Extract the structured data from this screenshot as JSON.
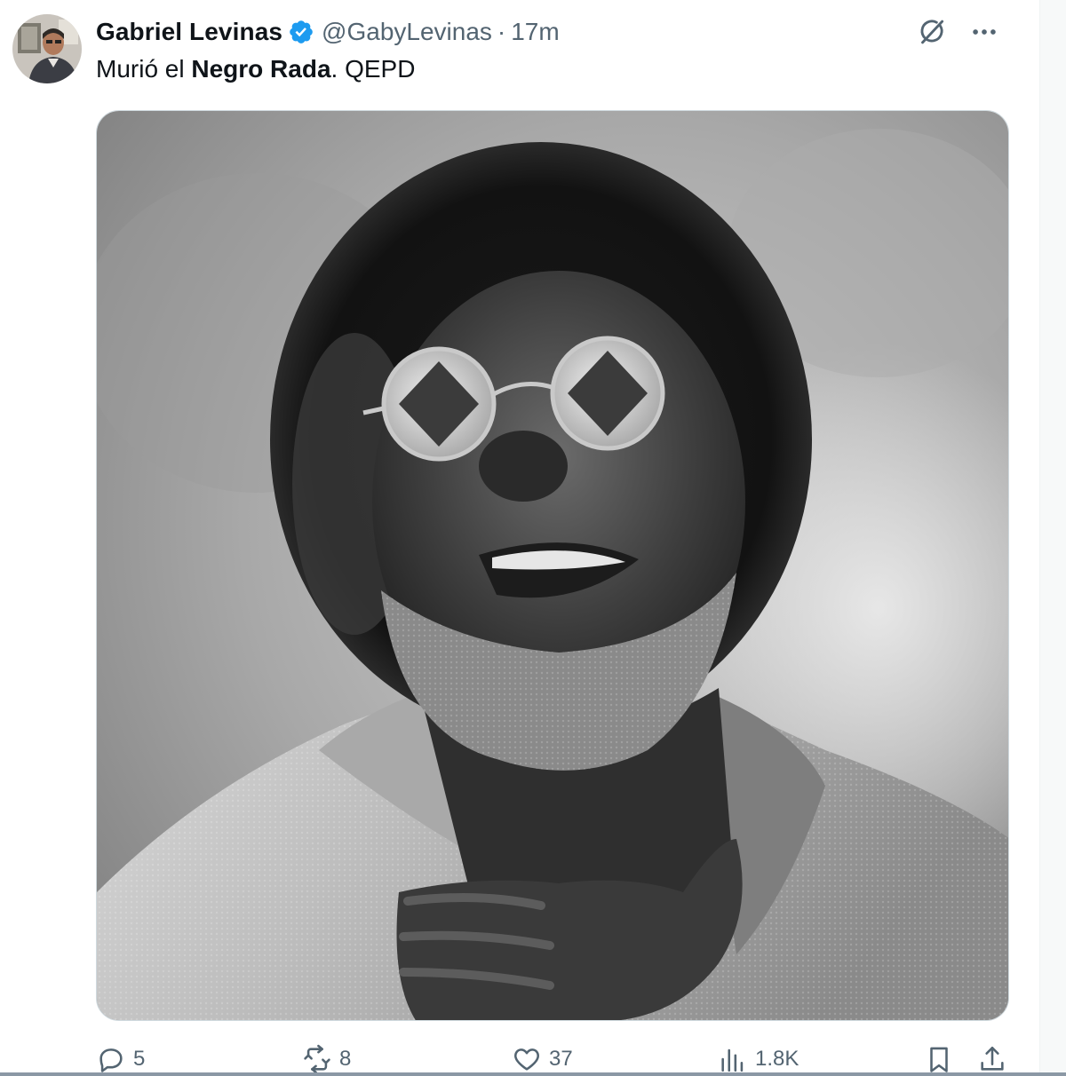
{
  "tweet": {
    "display_name": "Gabriel Levinas",
    "handle": "@GabyLevinas",
    "separator": "·",
    "time": "17m",
    "text_prefix": "Murió el",
    "text_bold": "Negro Rada",
    "text_suffix": ". QEPD",
    "verified": true
  },
  "header_actions": {
    "grok_icon": "grok-icon",
    "more_icon": "more-icon"
  },
  "actions": {
    "replies": "5",
    "reposts": "8",
    "likes": "37",
    "views": "1.8K"
  },
  "icons": {
    "reply": "reply-icon",
    "repost": "repost-icon",
    "like": "heart-icon",
    "views": "views-icon",
    "bookmark": "bookmark-icon",
    "share": "share-icon"
  },
  "colors": {
    "verified": "#1d9bf0",
    "secondary_text": "#536471",
    "primary_text": "#0f1419"
  }
}
